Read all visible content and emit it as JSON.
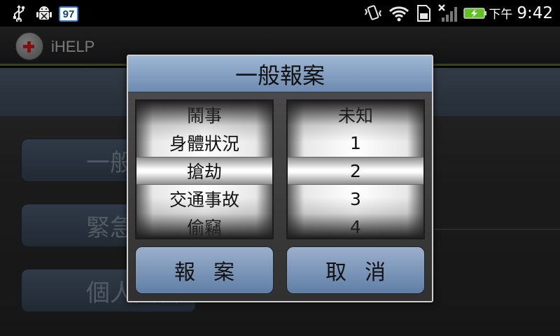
{
  "status_bar": {
    "icons": [
      "usb-icon",
      "android-debug-icon",
      "battery-badge-icon",
      "vibrate-icon",
      "wifi-icon",
      "sd-card-icon",
      "no-signal-icon",
      "battery-charging-icon"
    ],
    "battery_badge": "97",
    "ampm": "下午",
    "time": "9:42"
  },
  "app": {
    "title": "iHELP"
  },
  "background_buttons": [
    {
      "label": "一般"
    },
    {
      "label": "緊急"
    },
    {
      "label": "個人資料"
    }
  ],
  "dialog": {
    "title": "一般報案",
    "left_wheel": {
      "items": [
        "鬧事",
        "身體狀況",
        "搶劫",
        "交通事故",
        "偷竊"
      ],
      "selected": "搶劫"
    },
    "right_wheel": {
      "items": [
        "未知",
        "1",
        "2",
        "3",
        "4"
      ],
      "selected": "2"
    },
    "report_button": "報案",
    "cancel_button": "取消"
  },
  "colors": {
    "title_bar_blue": "#8aa3c4",
    "button_blue": "#7f98bb",
    "appbar_accent": "#4d6b2a",
    "battery_green": "#5fc21f"
  }
}
